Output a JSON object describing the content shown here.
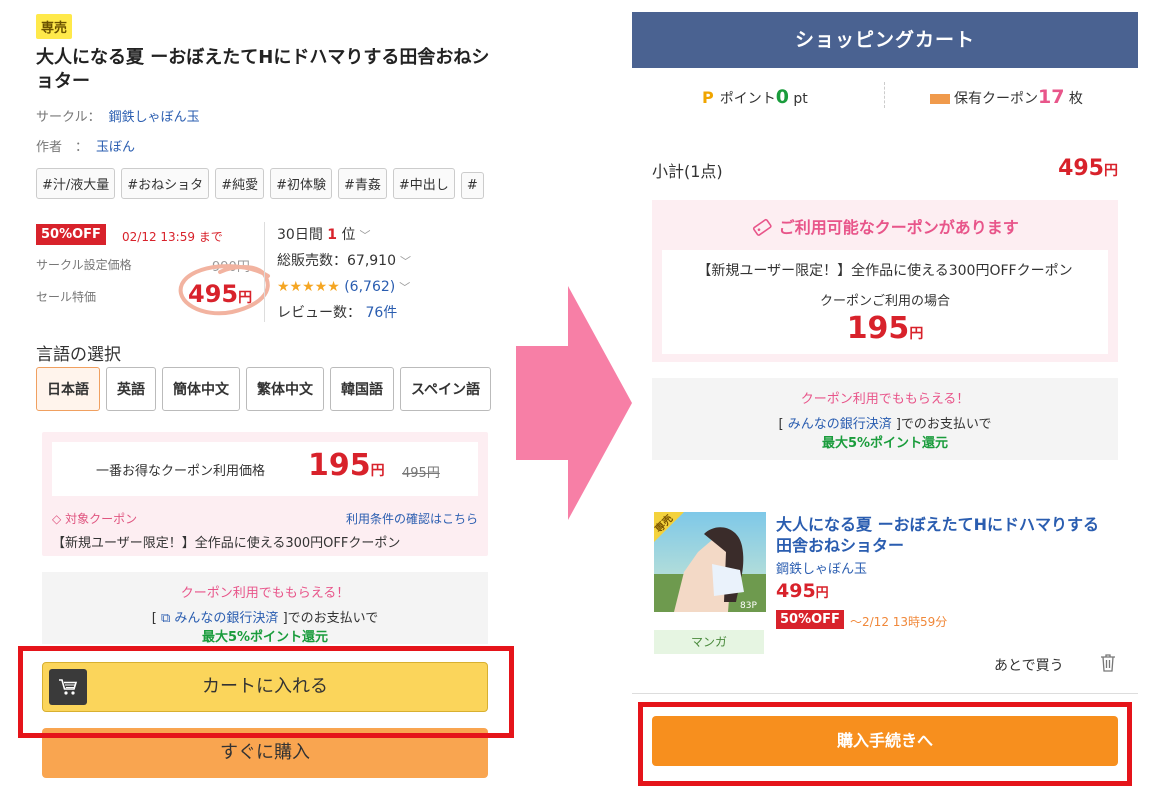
{
  "left": {
    "badge": "専売",
    "title": "大人になる夏 ーおぼえたてHにドハマりする田舎おねショター",
    "circle_label": "サークル：",
    "circle_name": "鋼鉄しゃぼん玉",
    "author_label": "作者　：",
    "author_name": "玉ぼん",
    "tags": [
      "#汁/液大量",
      "#おねショタ",
      "#純愛",
      "#初体験",
      "#青姦",
      "#中出し",
      "#"
    ],
    "sale_badge": "50%OFF",
    "sale_until": "02/12 13:59 まで",
    "orig_price_label": "サークル設定価格",
    "orig_price": "990円",
    "sale_price_label": "セール特価",
    "sale_price": "495",
    "yen": "円",
    "rank_prefix": "30日間",
    "rank_num": "1",
    "rank_suffix": "位",
    "sales": "総販売数：67,910",
    "stars": "★★★★★",
    "rating_count": "(6,762)",
    "reviews_label": "レビュー数：",
    "reviews": "76件",
    "lang_title": "言語の選択",
    "languages": [
      "日本語",
      "英語",
      "簡体中文",
      "繁体中文",
      "韓国語",
      "スペイン語"
    ],
    "coupon_label": "一番お得なクーポン利用価格",
    "coupon_price": "195",
    "coupon_strike": "495円",
    "coupon_target": "対象クーポン",
    "coupon_terms": "利用条件の確認はこちら",
    "coupon_desc": "【新規ユーザー限定！】全作品に使える300円OFFクーポン",
    "promo_head": "クーポン利用でももらえる！",
    "promo_pre": "[",
    "promo_link": "みんなの銀行決済",
    "promo_post": "]でのお支払いで",
    "promo_green": "最大5%ポイント還元",
    "cart_button": "カートに入れる",
    "buy_button": "すぐに購入"
  },
  "right": {
    "header": "ショッピングカート",
    "points_label": "ポイント",
    "points_value": "0",
    "points_unit": "pt",
    "coupons_label": "保有クーポン",
    "coupons_value": "17",
    "coupons_unit": "枚",
    "subtotal_label": "小計(1点)",
    "subtotal": "495",
    "yen": "円",
    "coupon_head": "ご利用可能なクーポンがあります",
    "coupon_desc": "【新規ユーザー限定！】全作品に使える300円OFFクーポン",
    "coupon_when": "クーポンご利用の場合",
    "coupon_price": "195",
    "promo_head": "クーポン利用でももらえる！",
    "promo_pre": "[",
    "promo_link": "みんなの銀行決済",
    "promo_post": "]でのお支払いで",
    "promo_green": "最大5%ポイント還元",
    "item_badge": "専売",
    "item_title": "大人になる夏 ーおぼえたてHにドハマりする田舎おねショター",
    "item_circle": "鋼鉄しゃぼん玉",
    "item_price": "495",
    "item_off": "50%OFF",
    "item_until": "～2/12 13時59分",
    "item_genre": "マンガ",
    "thumb_pages": "83P",
    "later": "あとで買う",
    "checkout": "購入手続きへ"
  },
  "colors": {
    "accent_red": "#d8222b",
    "header_blue": "#4a6291",
    "arrow_pink": "#f77fa6",
    "highlight": "#e5141a",
    "cart_yellow": "#fbd55b",
    "buy_orange": "#f9a550",
    "checkout_orange": "#f78f1e"
  }
}
